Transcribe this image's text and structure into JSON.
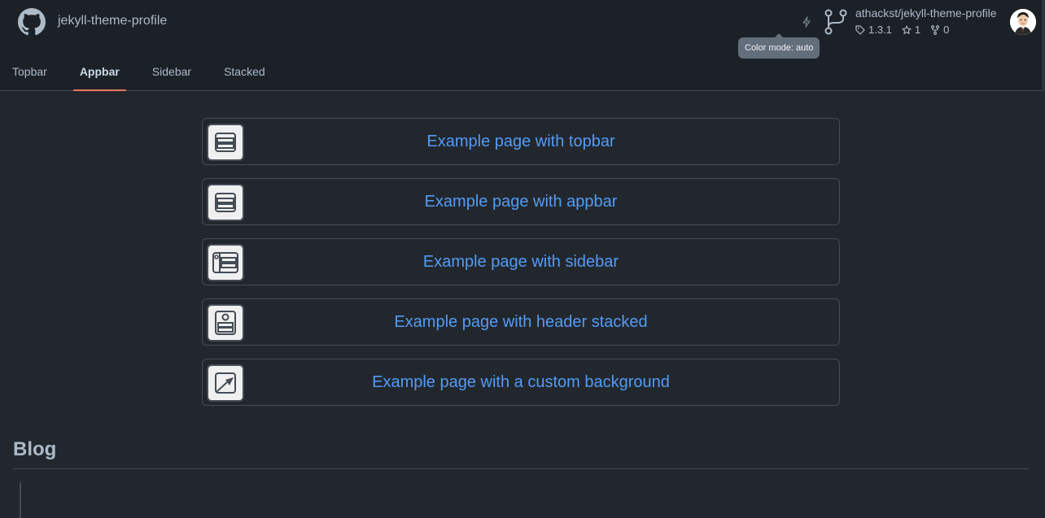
{
  "site": {
    "title": "jekyll-theme-profile"
  },
  "color_mode": {
    "tooltip": "Color mode: auto"
  },
  "repo": {
    "name": "athackst/jekyll-theme-profile",
    "version": "1.3.1",
    "stars": "1",
    "forks": "0"
  },
  "nav": {
    "tabs": [
      {
        "label": "Topbar"
      },
      {
        "label": "Appbar"
      },
      {
        "label": "Sidebar"
      },
      {
        "label": "Stacked"
      }
    ],
    "active": "Appbar"
  },
  "examples": [
    {
      "label": "Example page with topbar",
      "icon": "topbar-layout-icon"
    },
    {
      "label": "Example page with appbar",
      "icon": "appbar-layout-icon"
    },
    {
      "label": "Example page with sidebar",
      "icon": "sidebar-layout-icon"
    },
    {
      "label": "Example page with header stacked",
      "icon": "stacked-layout-icon"
    },
    {
      "label": "Example page with a custom background",
      "icon": "custom-background-icon"
    }
  ],
  "blog": {
    "heading": "Blog"
  },
  "colors": {
    "background": "#22272e",
    "header": "#1c2128",
    "link": "#539bf5",
    "active_tab_underline": "#ec775c",
    "border": "#444c56"
  }
}
